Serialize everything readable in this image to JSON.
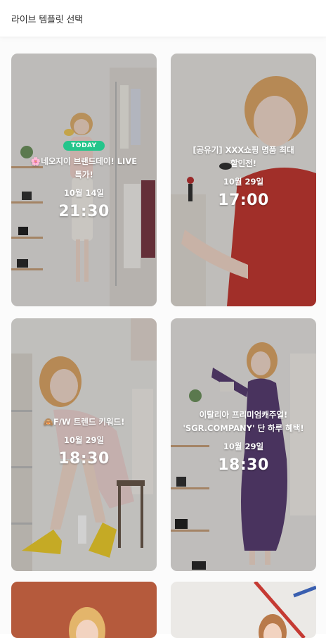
{
  "header": {
    "title": "라이브 템플릿 선택"
  },
  "cards": [
    {
      "badge": "TODAY",
      "title": "🌸네오지이 브랜드데이! LIVE 특가!",
      "date": "10월 14일",
      "time": "21:30"
    },
    {
      "badge": "",
      "title": "[공유기] XXX쇼핑 명품 최대 할인전!",
      "date": "10월 29일",
      "time": "17:00"
    },
    {
      "badge": "",
      "title": "🙈F/W 트렌드 키워드!",
      "date": "10월 29일",
      "time": "18:30"
    },
    {
      "badge": "",
      "title": "이탈리아 프리미엄캐주얼! 'SGR.COMPANY' 단 하루 혜택!",
      "date": "10월 29일",
      "time": "18:30"
    }
  ],
  "colors": {
    "badge": "#24c58b",
    "text": "#ffffff"
  }
}
